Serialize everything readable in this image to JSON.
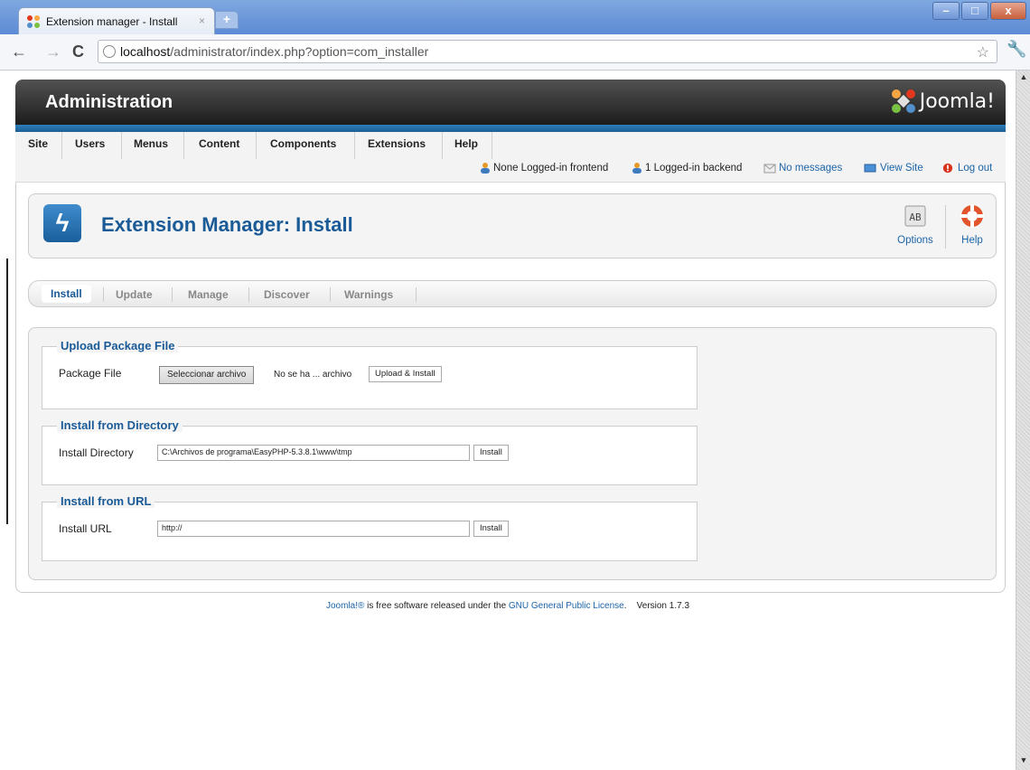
{
  "browser": {
    "tab_title": "Extension manager - Install",
    "tab_close": "×",
    "new_tab": "+",
    "url_host": "localhost",
    "url_path": "/administrator/index.php?option=com_installer",
    "window_buttons": [
      "–",
      "□",
      "x"
    ]
  },
  "header": {
    "brand": "Administration",
    "logo_text": "Joomla!"
  },
  "menu": {
    "items": [
      "Site",
      "Users",
      "Menus",
      "Content",
      "Components",
      "Extensions",
      "Help"
    ]
  },
  "status": {
    "frontend": "None Logged-in frontend",
    "backend": "1 Logged-in backend",
    "messages": "No messages",
    "view_site": "View Site",
    "logout": "Log out"
  },
  "title_bar": {
    "title": "Extension Manager: Install",
    "options_label": "Options",
    "help_label": "Help"
  },
  "subnav": {
    "items": [
      "Install",
      "Update",
      "Manage",
      "Discover",
      "Warnings"
    ],
    "active": "Install"
  },
  "upload": {
    "legend": "Upload Package File",
    "label": "Package File",
    "choose_button": "Seleccionar archivo",
    "file_name": "No se ha ... archivo",
    "submit": "Upload & Install"
  },
  "directory": {
    "legend": "Install from Directory",
    "label": "Install Directory",
    "value": "C:\\Archivos de programa\\EasyPHP-5.3.8.1\\www\\tmp",
    "submit": "Install"
  },
  "url": {
    "legend": "Install from URL",
    "label": "Install URL",
    "value": "http://",
    "submit": "Install"
  },
  "footer": {
    "joomla": "Joomla!®",
    "text1": " is free software released under the ",
    "license": "GNU General Public License",
    "text2": ".    Version 1.7.3"
  },
  "colors": {
    "accent": "#1a5a96",
    "header_bar": "#2f7fb9"
  }
}
